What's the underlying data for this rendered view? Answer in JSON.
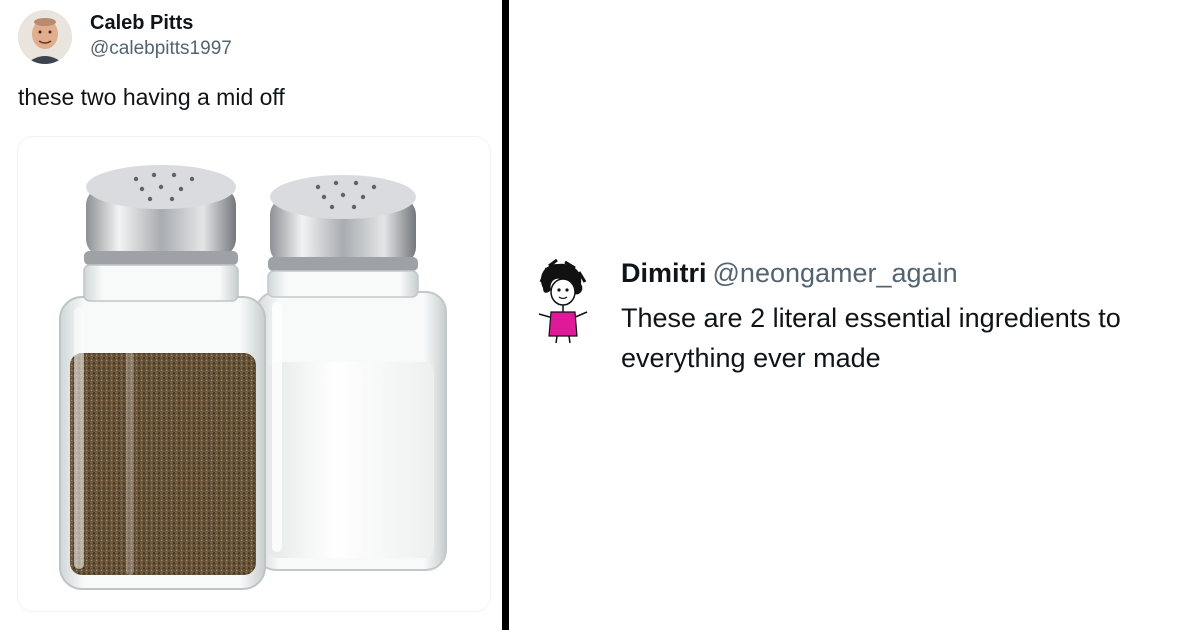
{
  "tweet": {
    "author_name": "Caleb Pitts",
    "author_handle": "@calebpitts1997",
    "text": "these two having a mid off",
    "media_subject": "salt and pepper shakers"
  },
  "reply": {
    "author_name": "Dimitri",
    "author_handle": "@neongamer_again",
    "text": "These are 2 literal essential ingredients to everything ever made"
  }
}
